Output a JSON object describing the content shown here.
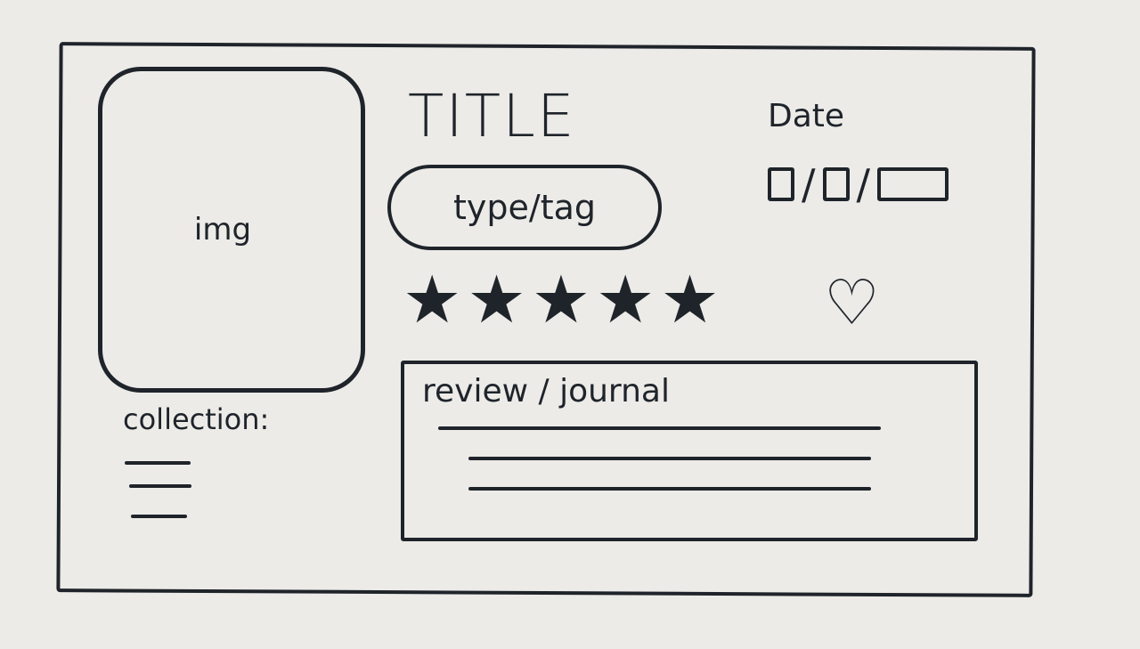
{
  "image_placeholder": "img",
  "title": "TITLE",
  "date": {
    "label": "Date",
    "separator1": "/",
    "separator2": "/"
  },
  "tag": "type/tag",
  "rating": {
    "stars": [
      "★",
      "★",
      "★",
      "★",
      "★"
    ],
    "max": 5
  },
  "favorite": "♡",
  "review": {
    "label": "review / journal"
  },
  "collection": {
    "label": "collection:"
  }
}
